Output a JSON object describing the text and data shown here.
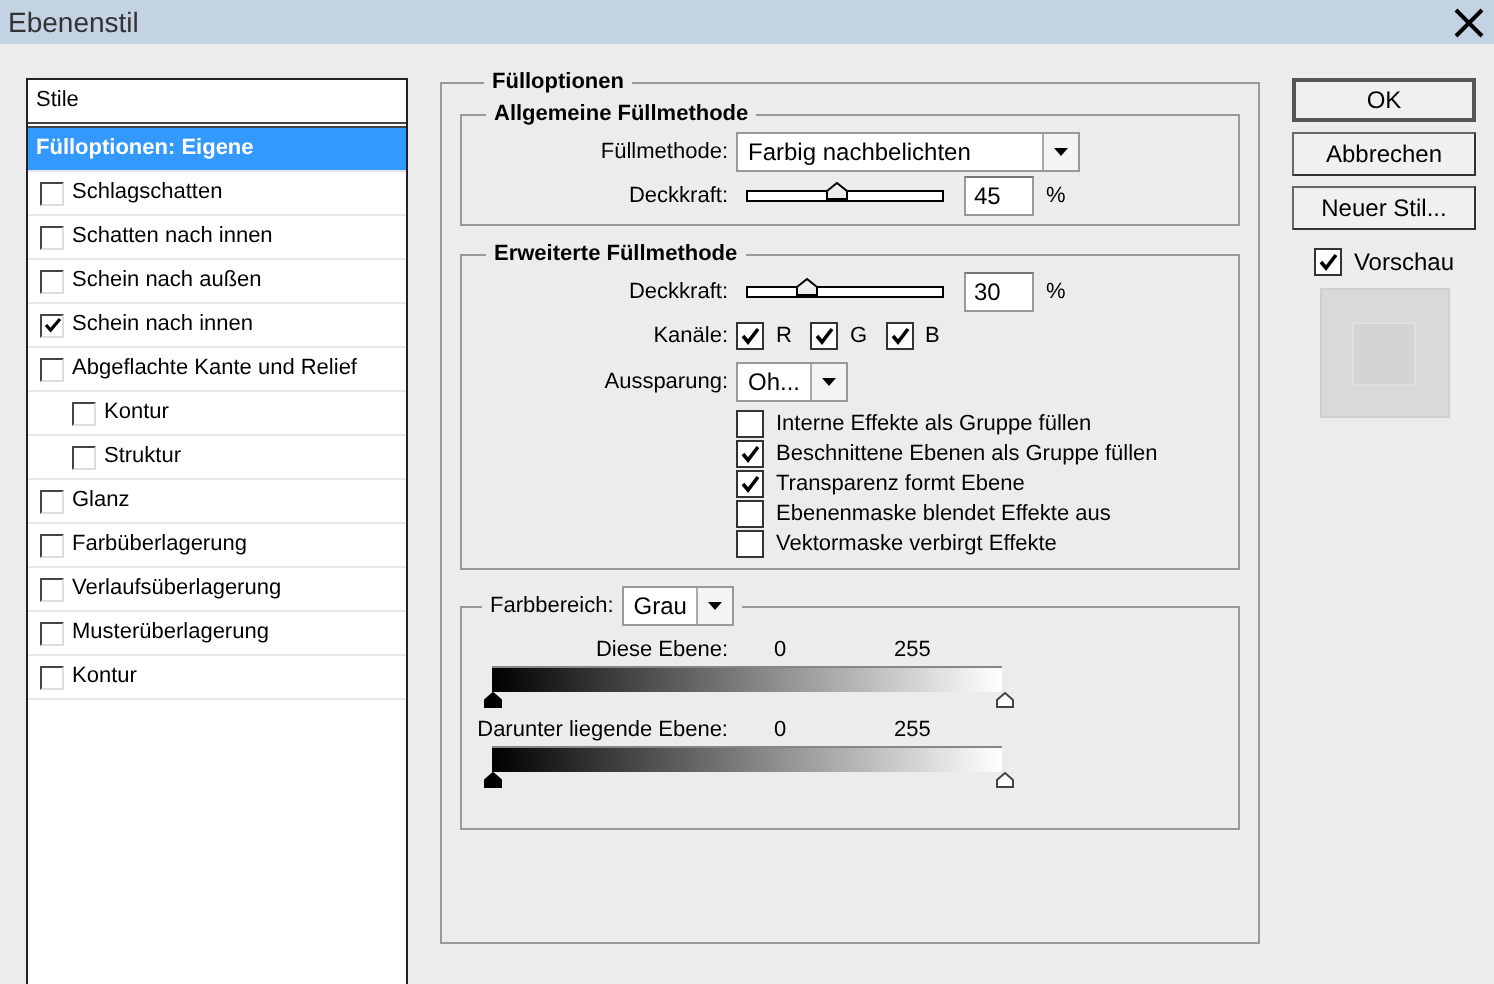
{
  "window": {
    "title": "Ebenenstil"
  },
  "styles": {
    "header": "Stile",
    "items": [
      {
        "kind": "heading",
        "label": "Fülloptionen: Eigene",
        "selected": true
      },
      {
        "kind": "checkbox",
        "label": "Schlagschatten",
        "checked": false,
        "selected": false
      },
      {
        "kind": "checkbox",
        "label": "Schatten nach innen",
        "checked": false,
        "selected": false
      },
      {
        "kind": "checkbox",
        "label": "Schein nach außen",
        "checked": false,
        "selected": false
      },
      {
        "kind": "checkbox",
        "label": "Schein nach innen",
        "checked": true,
        "selected": false
      },
      {
        "kind": "checkbox",
        "label": "Abgeflachte Kante und Relief",
        "checked": false,
        "selected": false,
        "children": [
          {
            "kind": "checkbox",
            "label": "Kontur",
            "checked": false,
            "selected": false
          },
          {
            "kind": "checkbox",
            "label": "Struktur",
            "checked": false,
            "selected": false
          }
        ]
      },
      {
        "kind": "checkbox",
        "label": "Glanz",
        "checked": false,
        "selected": false
      },
      {
        "kind": "checkbox",
        "label": "Farbüberlagerung",
        "checked": false,
        "selected": false
      },
      {
        "kind": "checkbox",
        "label": "Verlaufsüberlagerung",
        "checked": false,
        "selected": false
      },
      {
        "kind": "checkbox",
        "label": "Musterüberlagerung",
        "checked": false,
        "selected": false
      },
      {
        "kind": "checkbox",
        "label": "Kontur",
        "checked": false,
        "selected": false
      }
    ]
  },
  "fill_options": {
    "title": "Fülloptionen",
    "general": {
      "title": "Allgemeine Füllmethode",
      "blend_mode": {
        "label": "Füllmethode:",
        "value": "Farbig nachbelichten"
      },
      "opacity": {
        "label": "Deckkraft:",
        "level": 0.45,
        "value": "45",
        "unit": "%"
      }
    },
    "advanced": {
      "title": "Erweiterte Füllmethode",
      "opacity": {
        "label": "Deckkraft:",
        "level": 0.3,
        "value": "30",
        "unit": "%"
      },
      "channels": {
        "label": "Kanäle:",
        "items": [
          {
            "label": "R",
            "checked": true
          },
          {
            "label": "G",
            "checked": true
          },
          {
            "label": "B",
            "checked": true
          }
        ]
      },
      "knockout": {
        "label": "Aussparung:",
        "value": "Oh..."
      },
      "options": [
        {
          "label": "Interne Effekte als Gruppe füllen",
          "checked": false
        },
        {
          "label": "Beschnittene Ebenen als Gruppe füllen",
          "checked": true
        },
        {
          "label": "Transparenz formt Ebene",
          "checked": true
        },
        {
          "label": "Ebenenmaske blendet Effekte aus",
          "checked": false
        },
        {
          "label": "Vektormaske verbirgt Effekte",
          "checked": false
        }
      ]
    },
    "blend_if": {
      "label": "Farbbereich:",
      "value": "Grau",
      "bars": [
        {
          "label": "Diese Ebene:",
          "low": "0",
          "high": "255"
        },
        {
          "label": "Darunter liegende Ebene:",
          "low": "0",
          "high": "255"
        }
      ]
    }
  },
  "buttons": [
    "OK",
    "Abbrechen",
    "Neuer Stil..."
  ],
  "preview": {
    "label": "Vorschau",
    "checked": true
  }
}
